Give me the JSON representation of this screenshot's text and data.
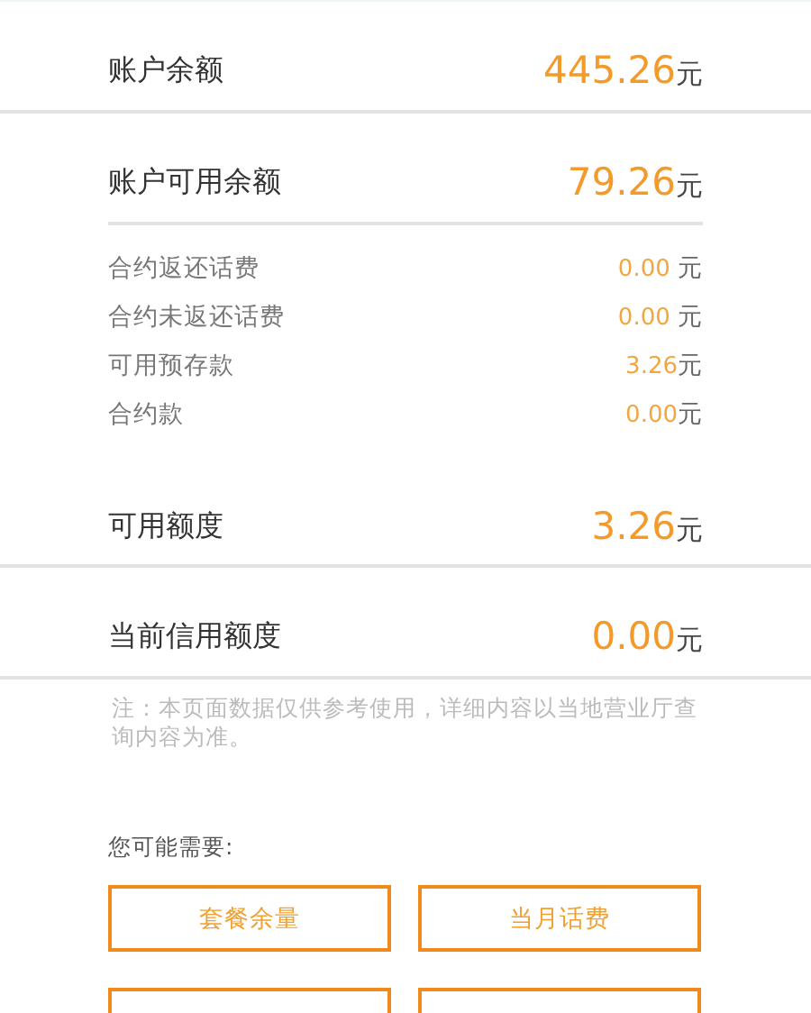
{
  "rows": [
    {
      "kind": "main",
      "label": "账户余额",
      "amount": "445.26",
      "unit": "元"
    },
    {
      "kind": "divider",
      "inset": false
    },
    {
      "kind": "main",
      "label": "账户可用余额",
      "amount": "79.26",
      "unit": "元"
    },
    {
      "kind": "divider",
      "inset": true
    },
    {
      "kind": "detail",
      "label": "合约返还话费",
      "amount": "0.00 ",
      "unit": "元"
    },
    {
      "kind": "detail",
      "label": "合约未返还话费",
      "amount": "0.00 ",
      "unit": "元"
    },
    {
      "kind": "detail",
      "label": "可用预存款",
      "amount": "3.26",
      "unit": "元"
    },
    {
      "kind": "detail",
      "label": "合约款",
      "amount": "0.00",
      "unit": "元"
    },
    {
      "kind": "main",
      "label": "可用额度",
      "amount": "3.26",
      "unit": "元"
    },
    {
      "kind": "divider",
      "inset": false
    },
    {
      "kind": "main",
      "label": "当前信用额度",
      "amount": "0.00",
      "unit": "元"
    },
    {
      "kind": "divider",
      "inset": false
    }
  ],
  "note": "注：本页面数据仅供参考使用，详细内容以当地营业厅查询内容为准。",
  "suggest_title": "您可能需要:",
  "buttons": [
    {
      "label": "套餐余量"
    },
    {
      "label": "当月话费"
    }
  ],
  "more_buttons_cut_off": true
}
